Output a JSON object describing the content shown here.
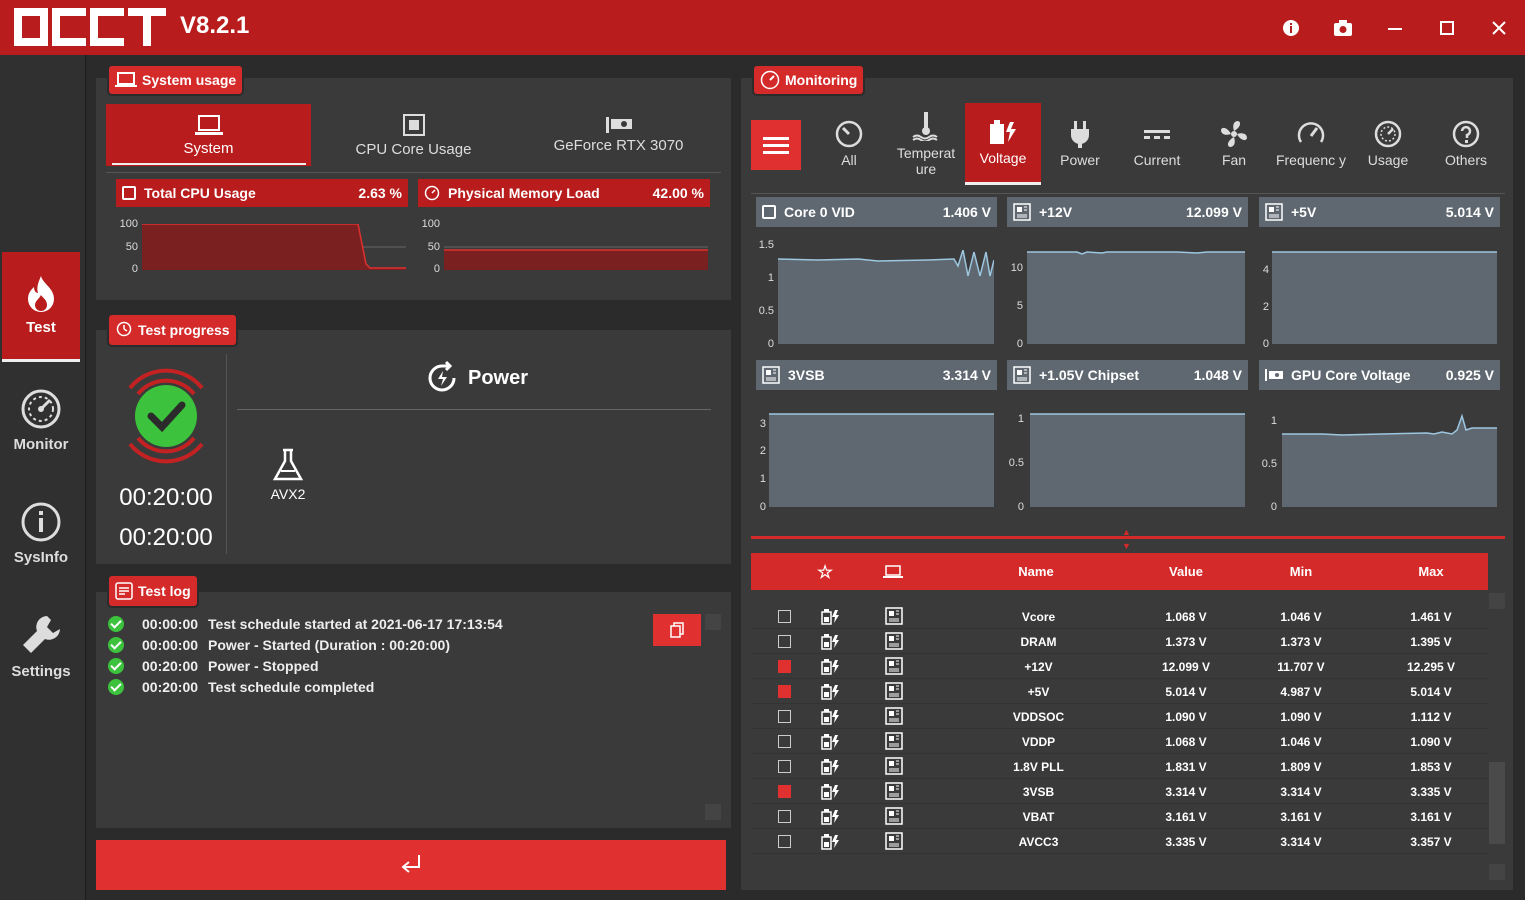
{
  "app": {
    "version": "V8.2.1"
  },
  "sidebar": {
    "items": [
      {
        "label": "Test",
        "icon": "flame-icon",
        "active": true
      },
      {
        "label": "Monitor",
        "icon": "gauge-icon"
      },
      {
        "label": "SysInfo",
        "icon": "info-icon"
      },
      {
        "label": "Settings",
        "icon": "wrench-icon"
      }
    ]
  },
  "system_usage": {
    "title": "System usage",
    "tabs": [
      {
        "label": "System",
        "active": true
      },
      {
        "label": "CPU Core Usage"
      },
      {
        "label": "GeForce RTX 3070"
      }
    ],
    "cpu": {
      "label": "Total CPU Usage",
      "value": "2.63 %",
      "axis": [
        "100",
        "50",
        "0"
      ]
    },
    "mem": {
      "label": "Physical Memory Load",
      "value": "42.00 %",
      "axis": [
        "100",
        "50",
        "0"
      ]
    }
  },
  "test_progress": {
    "title": "Test progress",
    "elapsed": "00:20:00",
    "total": "00:20:00",
    "test_name": "Power",
    "instruction": "AVX2"
  },
  "test_log": {
    "title": "Test log",
    "lines": [
      {
        "time": "00:00:00",
        "text": "Test schedule started at 2021-06-17 17:13:54"
      },
      {
        "time": "00:00:00",
        "text": "Power - Started (Duration : 00:20:00)"
      },
      {
        "time": "00:20:00",
        "text": "Power - Stopped"
      },
      {
        "time": "00:20:00",
        "text": "Test schedule completed"
      }
    ]
  },
  "monitoring": {
    "title": "Monitoring",
    "tabs": [
      {
        "label": "All",
        "icon": "gauge-icon"
      },
      {
        "label": "Temperat ure",
        "icon": "thermometer-icon"
      },
      {
        "label": "Voltage",
        "icon": "battery-bolt-icon",
        "active": true
      },
      {
        "label": "Power",
        "icon": "plug-icon"
      },
      {
        "label": "Current",
        "icon": "current-icon"
      },
      {
        "label": "Fan",
        "icon": "fan-icon"
      },
      {
        "label": "Frequenc y",
        "icon": "speedometer-icon"
      },
      {
        "label": "Usage",
        "icon": "usage-icon"
      },
      {
        "label": "Others",
        "icon": "question-icon"
      }
    ],
    "charts": [
      {
        "name": "Core 0 VID",
        "value": "1.406 V",
        "axis": [
          "1.5",
          "1",
          "0.5",
          "0"
        ]
      },
      {
        "name": "+12V",
        "value": "12.099 V",
        "axis": [
          "10",
          "5",
          "0"
        ]
      },
      {
        "name": "+5V",
        "value": "5.014 V",
        "axis": [
          "4",
          "2",
          "0"
        ]
      },
      {
        "name": "3VSB",
        "value": "3.314 V",
        "axis": [
          "3",
          "2",
          "1",
          "0"
        ]
      },
      {
        "name": "+1.05V Chipset",
        "value": "1.048 V",
        "axis": [
          "1",
          "0.5",
          "0"
        ]
      },
      {
        "name": "GPU Core Voltage",
        "value": "0.925 V",
        "axis": [
          "1",
          "0.5",
          "0"
        ]
      }
    ],
    "table": {
      "headers": {
        "name": "Name",
        "value": "Value",
        "min": "Min",
        "max": "Max"
      },
      "rows": [
        {
          "checked": false,
          "name": "Vcore",
          "value": "1.068 V",
          "min": "1.046 V",
          "max": "1.461 V"
        },
        {
          "checked": false,
          "name": "DRAM",
          "value": "1.373 V",
          "min": "1.373 V",
          "max": "1.395 V"
        },
        {
          "checked": true,
          "name": "+12V",
          "value": "12.099 V",
          "min": "11.707 V",
          "max": "12.295 V"
        },
        {
          "checked": true,
          "name": "+5V",
          "value": "5.014 V",
          "min": "4.987 V",
          "max": "5.014 V"
        },
        {
          "checked": false,
          "name": "VDDSOC",
          "value": "1.090 V",
          "min": "1.090 V",
          "max": "1.112 V"
        },
        {
          "checked": false,
          "name": "VDDP",
          "value": "1.068 V",
          "min": "1.046 V",
          "max": "1.090 V"
        },
        {
          "checked": false,
          "name": "1.8V PLL",
          "value": "1.831 V",
          "min": "1.809 V",
          "max": "1.853 V"
        },
        {
          "checked": true,
          "name": "3VSB",
          "value": "3.314 V",
          "min": "3.314 V",
          "max": "3.335 V"
        },
        {
          "checked": false,
          "name": "VBAT",
          "value": "3.161 V",
          "min": "3.161 V",
          "max": "3.161 V"
        },
        {
          "checked": false,
          "name": "AVCC3",
          "value": "3.335 V",
          "min": "3.314 V",
          "max": "3.357 V"
        }
      ]
    }
  },
  "colors": {
    "accent": "#b81c1c",
    "accent_bright": "#d42a2a",
    "ok": "#3cc23c",
    "chart_fill": "#5f6870"
  }
}
